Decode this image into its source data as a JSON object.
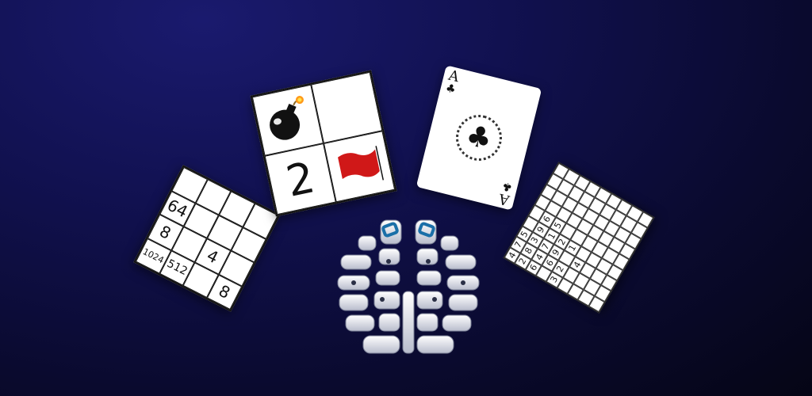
{
  "tiles_2048": [
    "",
    "",
    "",
    "",
    "64",
    "",
    "",
    "",
    "8",
    "",
    "4",
    "",
    "1024",
    "512",
    "",
    "",
    "2",
    "",
    "8",
    "",
    "",
    "64",
    "",
    ""
  ],
  "grid_2048": [
    [
      "",
      "",
      "",
      ""
    ],
    [
      "64",
      "",
      "",
      ""
    ],
    [
      "8",
      "",
      "4",
      ""
    ],
    [
      "1024",
      "512",
      "",
      "8"
    ]
  ],
  "minesweeper": {
    "number": "2"
  },
  "card": {
    "rank": "A",
    "suit": "♣"
  },
  "sudoku": [
    "4",
    "7",
    "5",
    "",
    "",
    "",
    "",
    "",
    "",
    "2",
    "8",
    "3",
    "9",
    "6",
    "",
    "",
    "",
    "",
    "6",
    "4",
    "7",
    "1",
    "5",
    "",
    "",
    "",
    "",
    "",
    "6",
    "9",
    "2",
    "",
    "",
    "",
    "",
    "",
    "3",
    "2",
    "",
    "1",
    "",
    "",
    "",
    "",
    "",
    "",
    "",
    "4",
    "",
    "",
    "",
    "",
    "",
    "",
    "",
    "",
    "",
    "",
    "",
    "",
    "",
    "",
    "",
    ""
  ],
  "colors": {
    "background": "#111150",
    "brain_accent": "#1a6fa8",
    "flag": "#d01818"
  }
}
